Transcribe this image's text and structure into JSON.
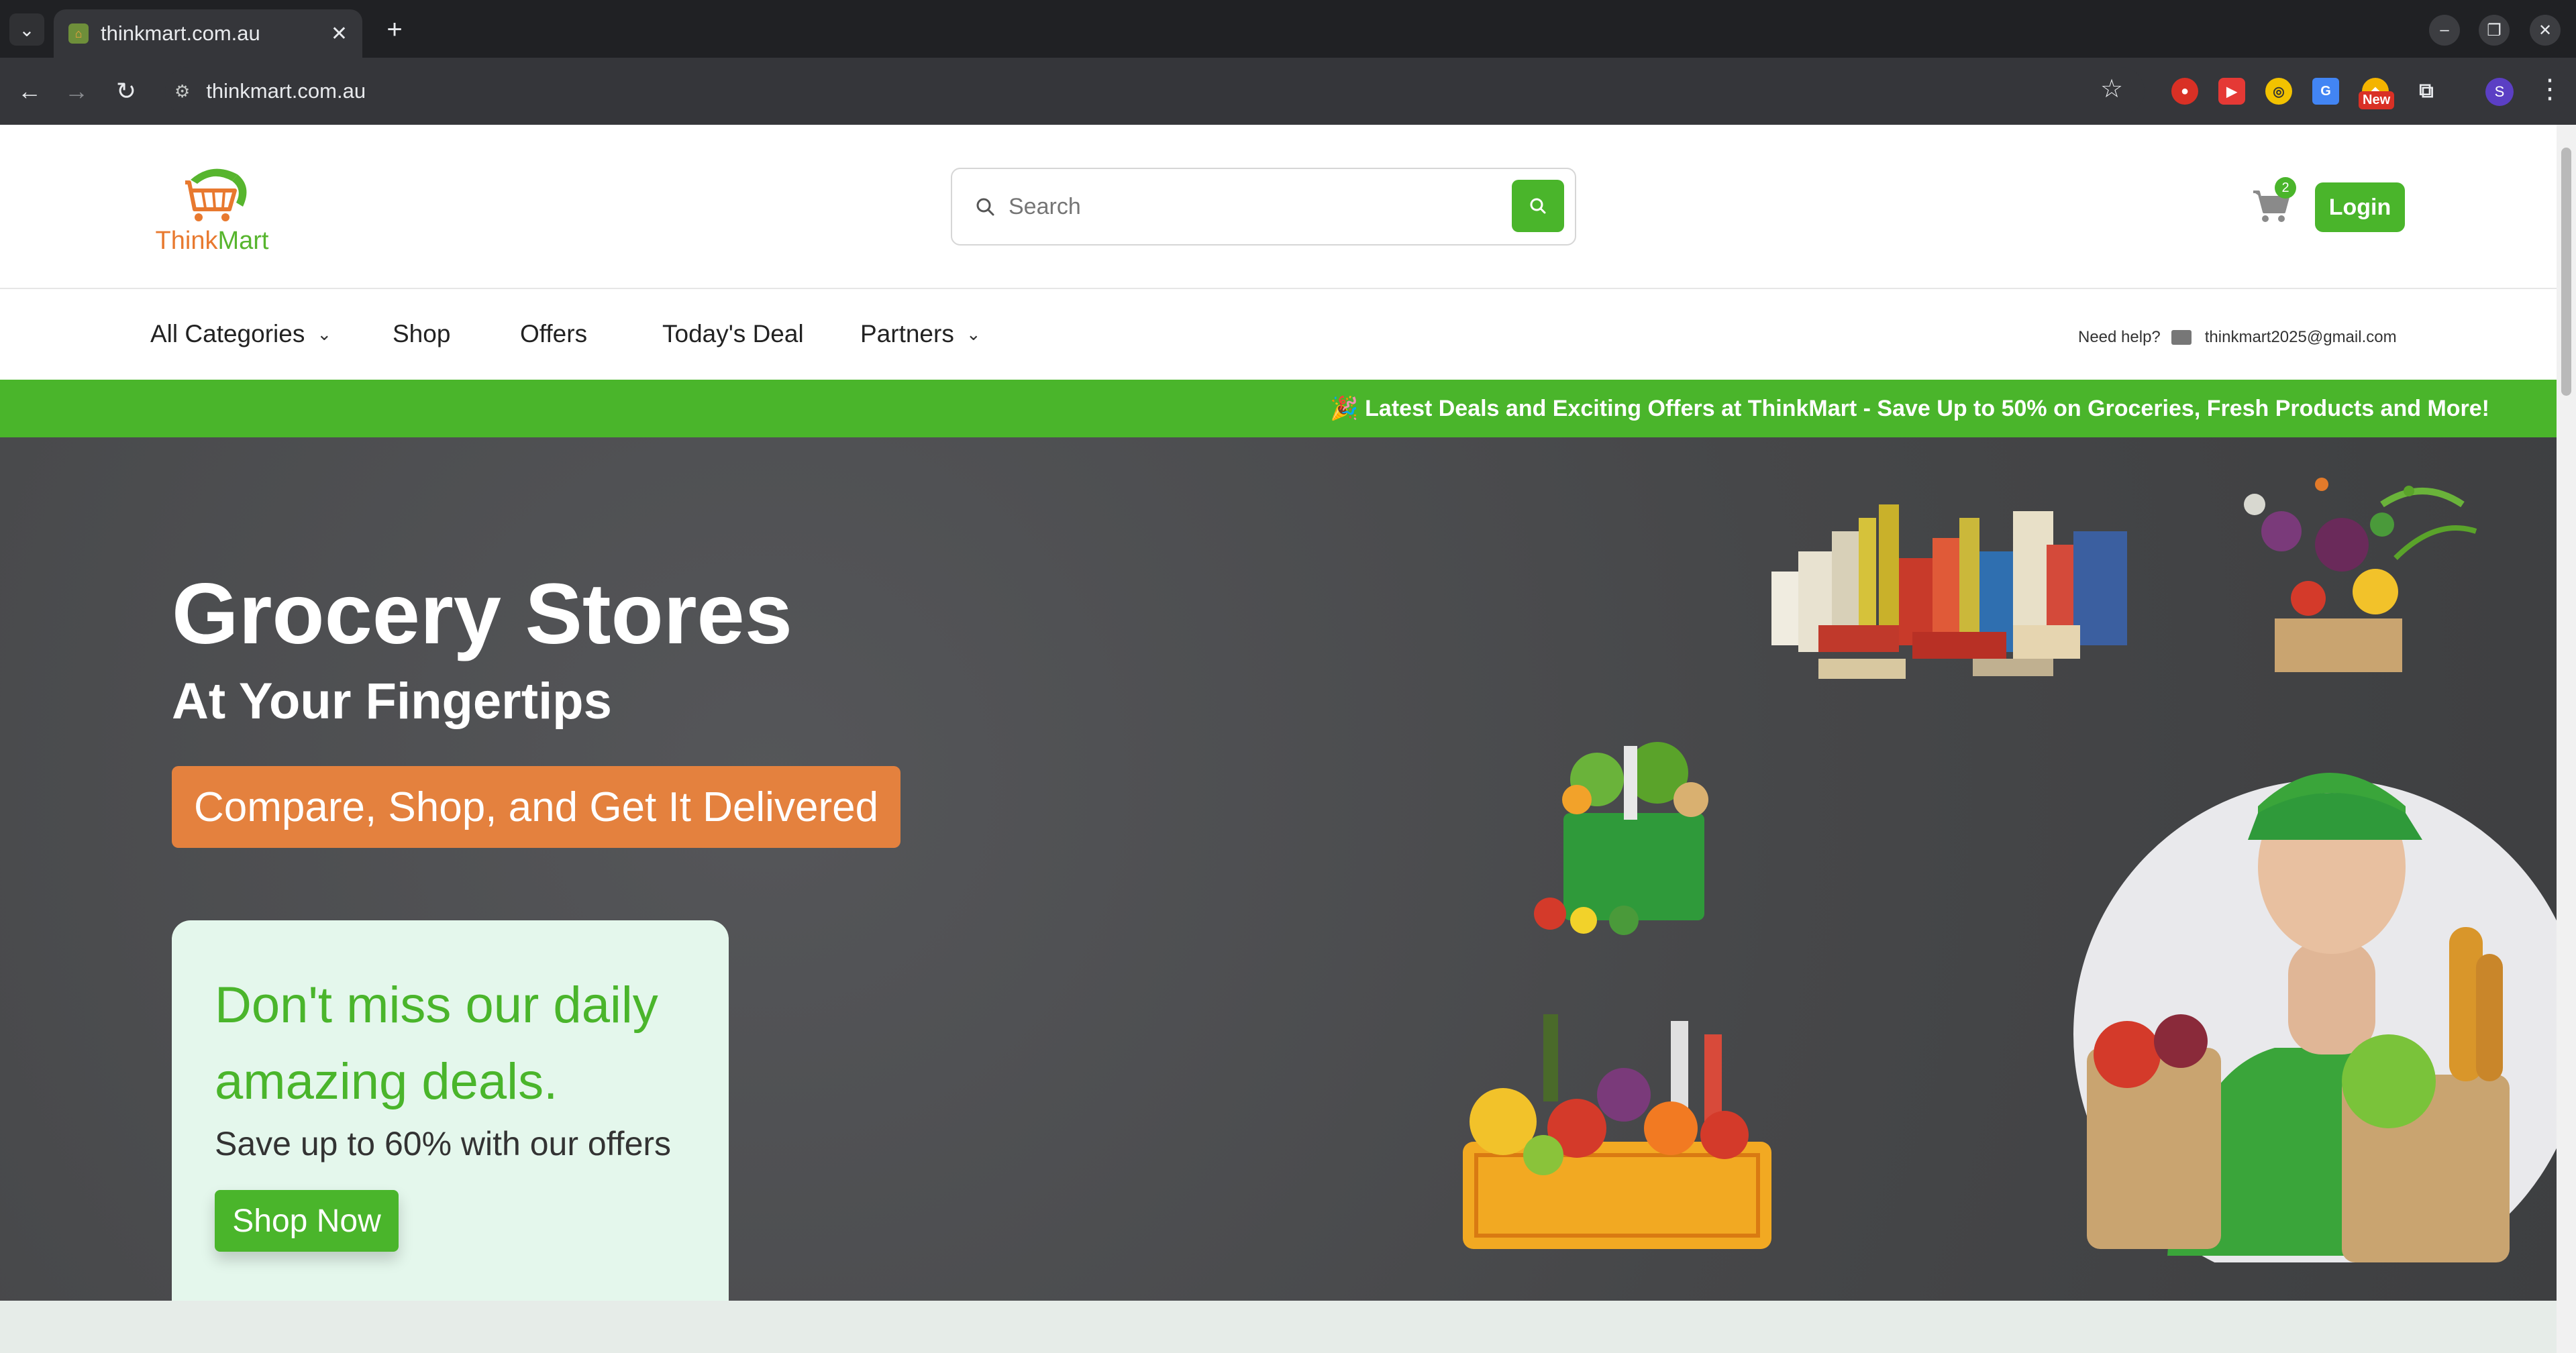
{
  "browser": {
    "tab_title": "thinkmart.com.au",
    "url": "thinkmart.com.au",
    "new_badge": "New",
    "profile_initial": "S"
  },
  "header": {
    "logo_think": "Think",
    "logo_mart": "Mart",
    "search_placeholder": "Search",
    "cart_count": "2",
    "login_label": "Login"
  },
  "nav": {
    "items": [
      {
        "label": "All Categories",
        "has_dropdown": true
      },
      {
        "label": "Shop",
        "has_dropdown": false
      },
      {
        "label": "Offers",
        "has_dropdown": false
      },
      {
        "label": "Today's Deal",
        "has_dropdown": false
      },
      {
        "label": "Partners",
        "has_dropdown": true
      }
    ],
    "help_label": "Need help?",
    "help_email": "thinkmart2025@gmail.com"
  },
  "promo": {
    "text": "🎉 Latest Deals and Exciting Offers at ThinkMart - Save Up to 50% on Groceries, Fresh Products and More!"
  },
  "hero": {
    "title": "Grocery Stores",
    "subtitle": "At Your Fingertips",
    "cta": "Compare, Shop, and Get It Delivered",
    "deal_title": "Don't miss our daily amazing deals.",
    "deal_subtitle": "Save up to 60% with our offers",
    "deal_button": "Shop Now"
  },
  "colors": {
    "brand_green": "#4ab52b",
    "brand_orange": "#e4813e",
    "deal_card_bg": "#e4f7ec",
    "hero_bg": "#4a4b4d"
  }
}
